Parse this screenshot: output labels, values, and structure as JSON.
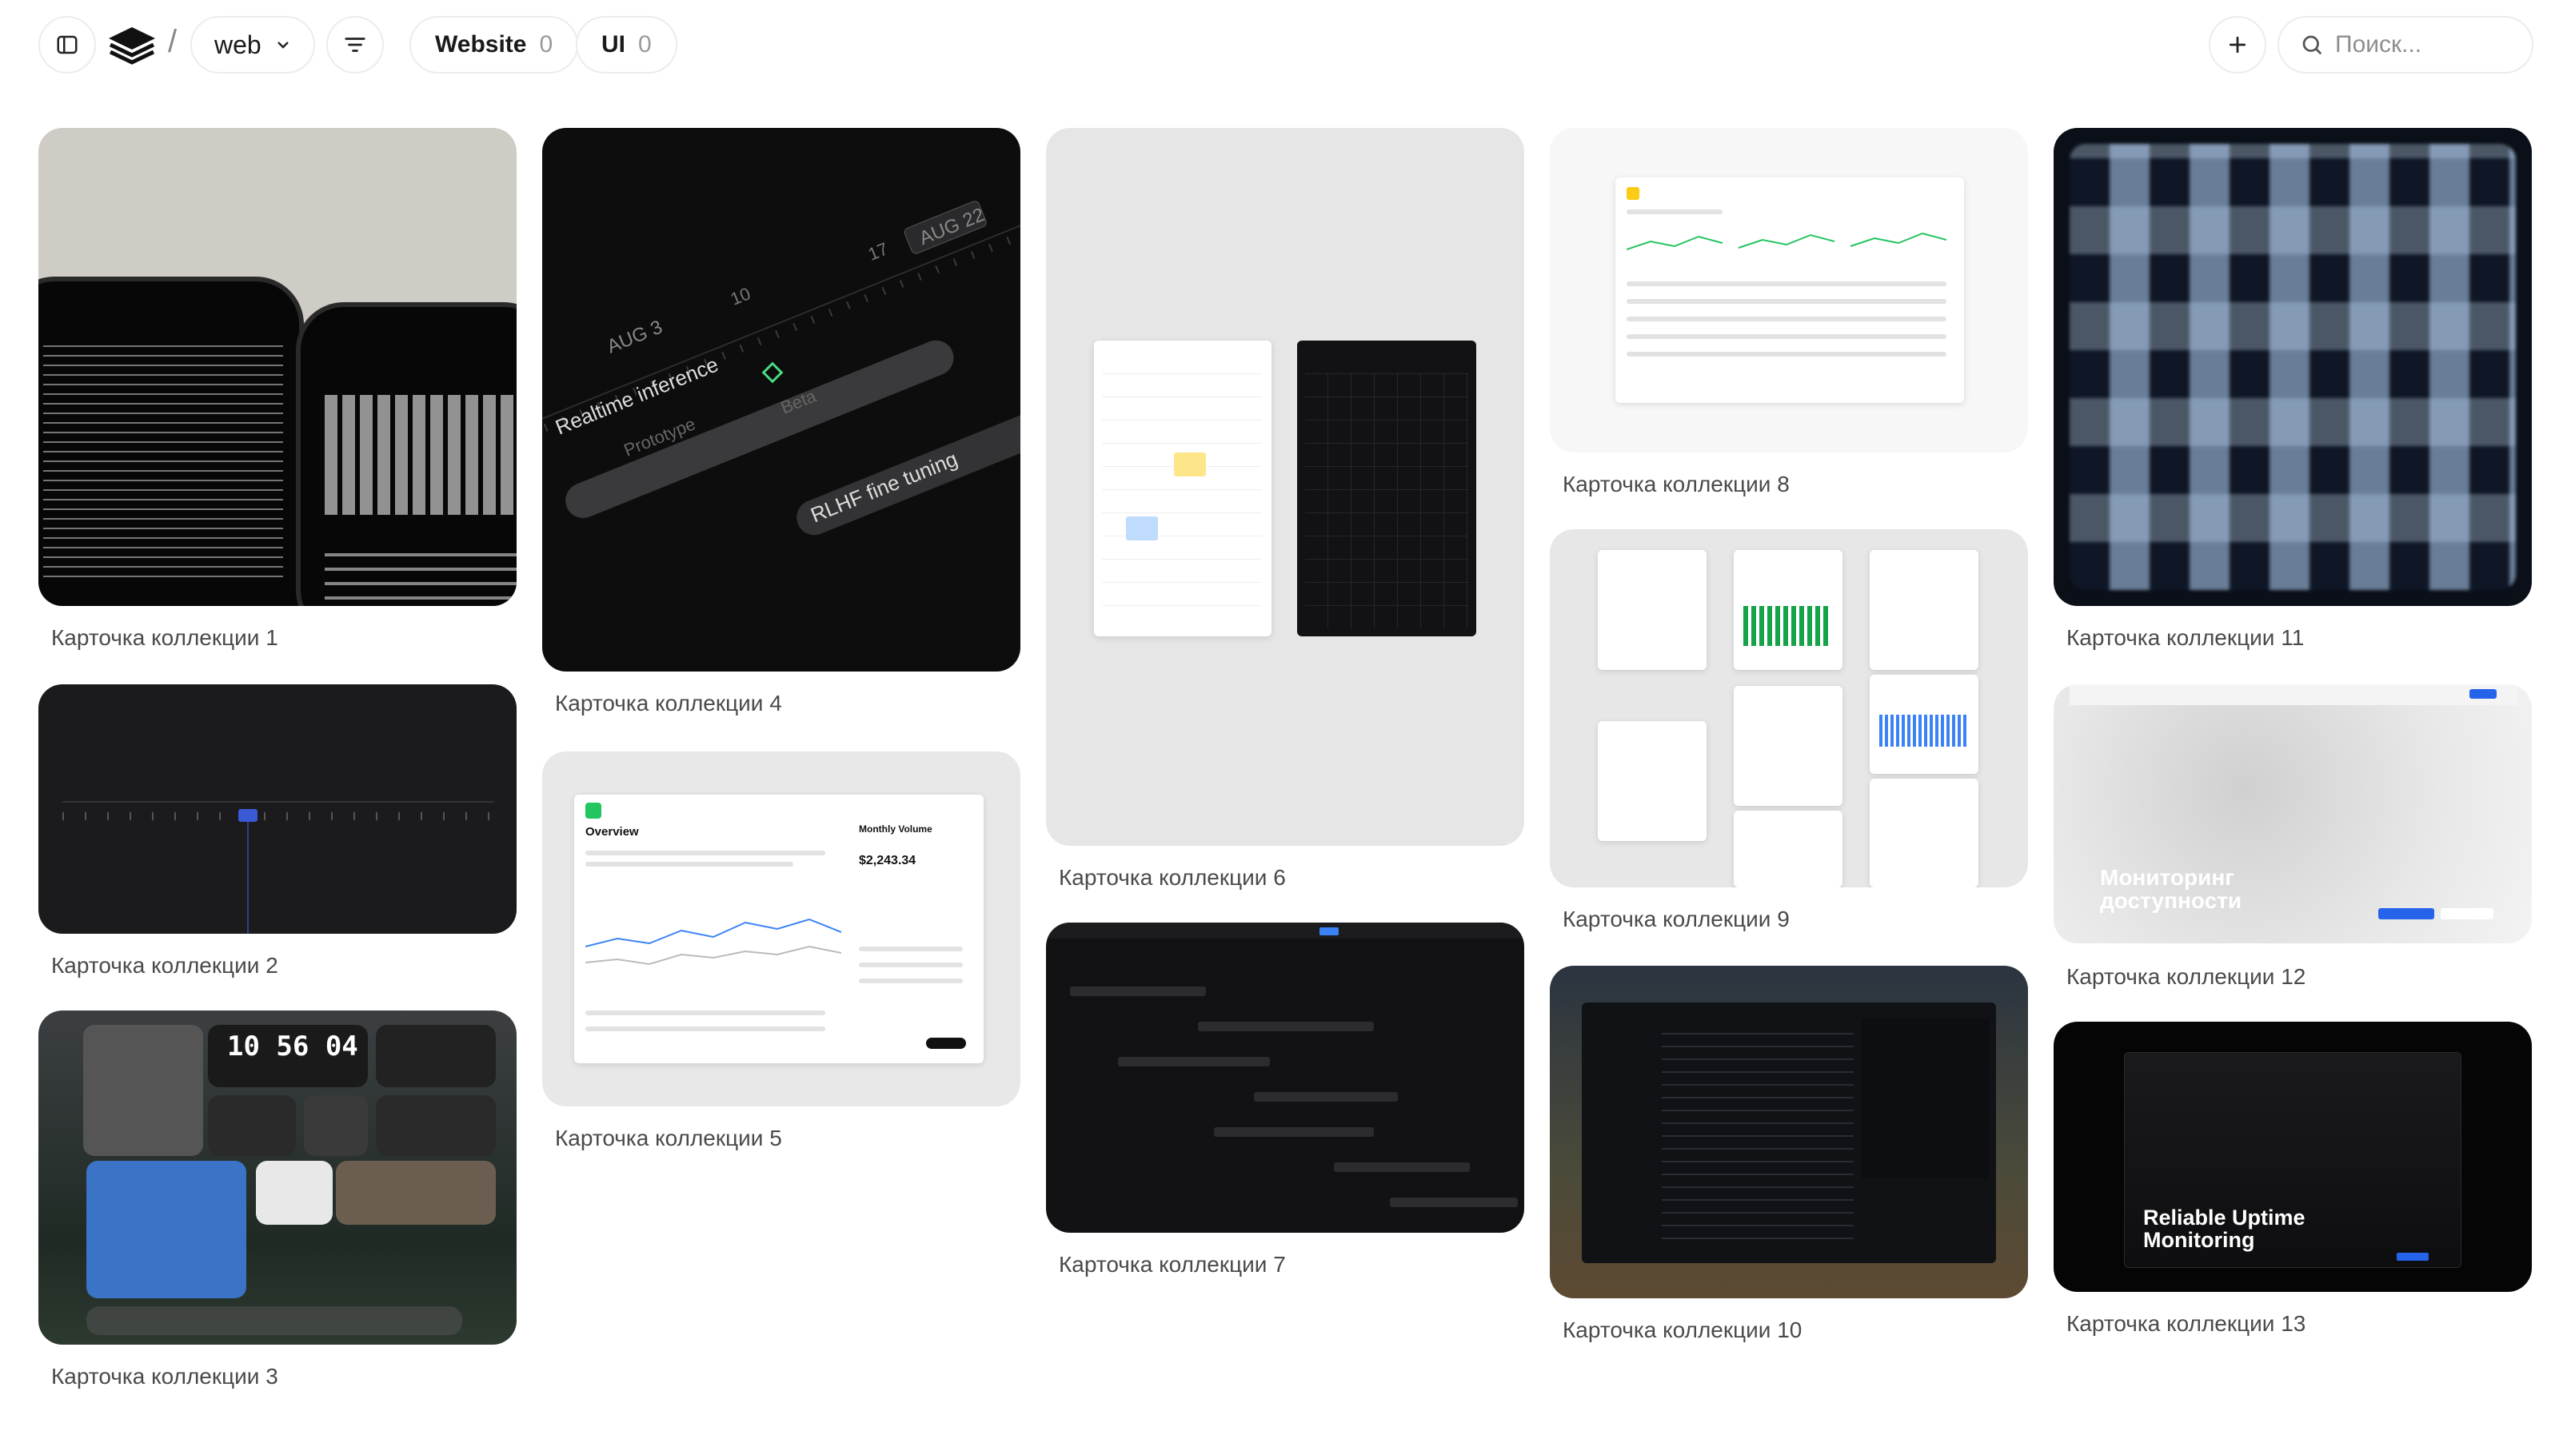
{
  "toolbar": {
    "selector_value": "web",
    "separator": "/",
    "chips": [
      {
        "label": "Website",
        "count": "0"
      },
      {
        "label": "UI",
        "count": "0"
      }
    ],
    "search_placeholder": "Поиск..."
  },
  "icons": {
    "sidebar_toggle": "sidebar-toggle-icon",
    "logo": "layers-logo-icon",
    "chevron": "chevron-down-icon",
    "filter": "filter-lines-icon",
    "add": "plus-icon",
    "search": "search-icon"
  },
  "cards": [
    {
      "caption": "Карточка коллекции 1"
    },
    {
      "caption": "Карточка коллекции 2"
    },
    {
      "caption": "Карточка коллекции 3"
    },
    {
      "caption": "Карточка коллекции 4"
    },
    {
      "caption": "Карточка коллекции 5"
    },
    {
      "caption": "Карточка коллекции 6"
    },
    {
      "caption": "Карточка коллекции 7"
    },
    {
      "caption": "Карточка коллекции 8"
    },
    {
      "caption": "Карточка коллекции 9"
    },
    {
      "caption": "Карточка коллекции 10"
    },
    {
      "caption": "Карточка коллекции 11"
    },
    {
      "caption": "Карточка коллекции 12"
    },
    {
      "caption": "Карточка коллекции 13"
    }
  ],
  "thumb_text": {
    "card4": {
      "date_a": "AUG 3",
      "date_b": "AUG 22",
      "label_1": "Realtime inference",
      "label_2": "Prototype",
      "label_3": "Beta",
      "label_4": "RLHF fine tuning",
      "tick_1": "10",
      "tick_2": "17"
    },
    "card3": {
      "clock": "10 56 04"
    },
    "card5": {
      "title": "Overview",
      "side_title": "Monthly Volume",
      "amount": "$2,243.34"
    },
    "card12": {
      "headline": "Мониторинг доступности"
    },
    "card13": {
      "headline": "Reliable Uptime Monitoring"
    }
  },
  "colors": {
    "border": "#ececec",
    "caption": "#4a4a4a",
    "accent_green": "#22c55e",
    "accent_blue": "#2563eb"
  }
}
